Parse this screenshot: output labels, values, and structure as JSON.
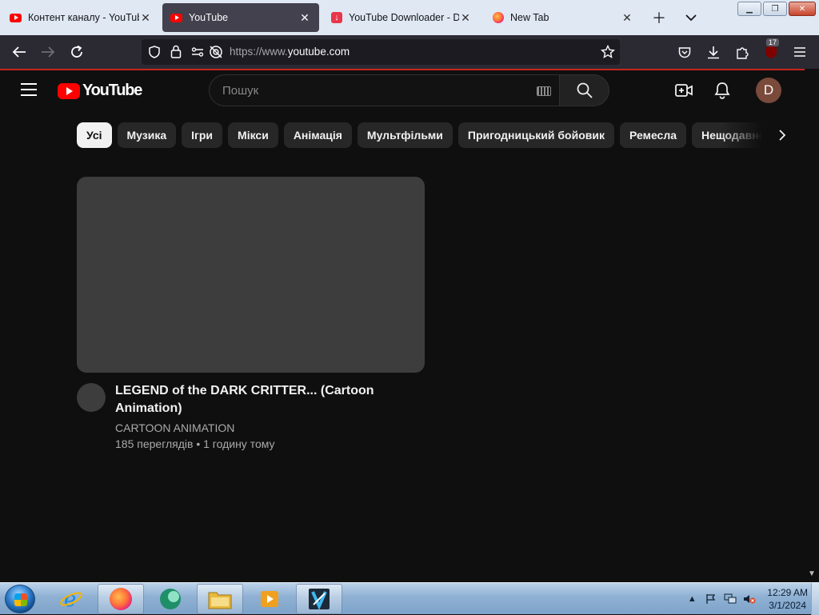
{
  "browser": {
    "tabs": [
      {
        "title": "Контент каналу - YouTube",
        "icon": "youtube-favicon",
        "active": false
      },
      {
        "title": "YouTube",
        "icon": "youtube-favicon",
        "active": true
      },
      {
        "title": "YouTube Downloader - Do",
        "icon": "download-favicon",
        "active": false
      },
      {
        "title": "New Tab",
        "icon": "firefox-favicon",
        "active": false
      }
    ],
    "url": {
      "prefix": "https://www.",
      "host": "youtube.com"
    },
    "extension_badge": "17",
    "accent": "#c4261d"
  },
  "youtube": {
    "logo_text": "YouTube",
    "search_placeholder": "Пошук",
    "avatar_letter": "D",
    "chips": [
      "Усі",
      "Музика",
      "Ігри",
      "Мікси",
      "Анімація",
      "Мультфільми",
      "Пригодницький бойовик",
      "Ремесла",
      "Нещодавно"
    ],
    "selected_chip": "Усі",
    "video": {
      "title": "LEGEND of the DARK CRITTER... (Cartoon Animation)",
      "channel": "CARTOON ANIMATION",
      "meta": "185 переглядів • 1 годину тому"
    }
  },
  "taskbar": {
    "apps": [
      "internet-explorer",
      "firefox",
      "app-green",
      "file-explorer",
      "media-player",
      "video-editor"
    ],
    "time": "12:29 AM",
    "date": "3/1/2024"
  }
}
